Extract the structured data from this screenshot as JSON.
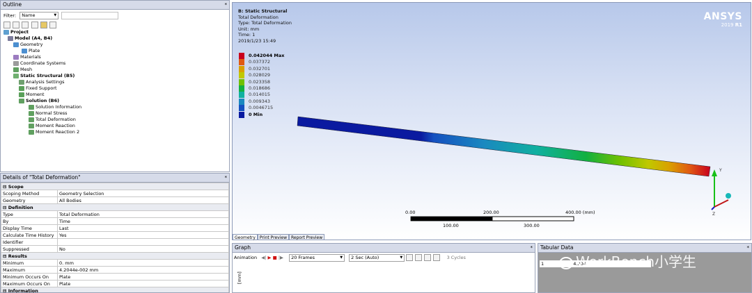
{
  "outline": {
    "title": "Outline",
    "filter_label": "Filter:",
    "filter_value": "Name",
    "tree": [
      {
        "label": "Project",
        "bold": true
      },
      {
        "label": "Model (A4, B4)",
        "bold": true
      },
      {
        "label": "Geometry",
        "bold": false
      },
      {
        "label": "Plate",
        "bold": false
      },
      {
        "label": "Materials",
        "bold": false
      },
      {
        "label": "Coordinate Systems",
        "bold": false
      },
      {
        "label": "Mesh",
        "bold": false
      },
      {
        "label": "Static Structural (B5)",
        "bold": true
      },
      {
        "label": "Analysis Settings",
        "bold": false
      },
      {
        "label": "Fixed Support",
        "bold": false
      },
      {
        "label": "Moment",
        "bold": false
      },
      {
        "label": "Solution (B6)",
        "bold": true
      },
      {
        "label": "Solution Information",
        "bold": false
      },
      {
        "label": "Normal Stress",
        "bold": false
      },
      {
        "label": "Total Deformation",
        "bold": false
      },
      {
        "label": "Moment Reaction",
        "bold": false
      },
      {
        "label": "Moment Reaction 2",
        "bold": false
      }
    ]
  },
  "details": {
    "title": "Details of \"Total Deformation\"",
    "rows": [
      {
        "section": "Scope"
      },
      {
        "k": "Scoping Method",
        "v": "Geometry Selection"
      },
      {
        "k": "Geometry",
        "v": "All Bodies"
      },
      {
        "section": "Definition"
      },
      {
        "k": "Type",
        "v": "Total Deformation"
      },
      {
        "k": "By",
        "v": "Time"
      },
      {
        "k": "Display Time",
        "v": "Last"
      },
      {
        "k": "Calculate Time History",
        "v": "Yes"
      },
      {
        "k": "Identifier",
        "v": ""
      },
      {
        "k": "Suppressed",
        "v": "No"
      },
      {
        "section": "Results"
      },
      {
        "k": "Minimum",
        "v": "0. mm"
      },
      {
        "k": "Maximum",
        "v": "4.2044e-002 mm"
      },
      {
        "k": "Minimum Occurs On",
        "v": "Plate"
      },
      {
        "k": "Maximum Occurs On",
        "v": "Plate"
      },
      {
        "section": "Information"
      }
    ]
  },
  "viewport": {
    "header": [
      "B: Static Structural",
      "Total Deformation",
      "Type: Total Deformation",
      "Unit: mm",
      "Time: 1",
      "2019/1/23 15:49"
    ],
    "brand": "ANSYS",
    "version": "2019",
    "release": "R1",
    "legend": [
      {
        "label": "0.042044 Max",
        "color": "#c8001e"
      },
      {
        "label": "0.037372",
        "color": "#e05a12"
      },
      {
        "label": "0.032701",
        "color": "#d9a100"
      },
      {
        "label": "0.028029",
        "color": "#c0c800"
      },
      {
        "label": "0.023358",
        "color": "#6fc000"
      },
      {
        "label": "0.018686",
        "color": "#12b040"
      },
      {
        "label": "0.014015",
        "color": "#10b0a0"
      },
      {
        "label": "0.009343",
        "color": "#1a88c0"
      },
      {
        "label": "0.0046715",
        "color": "#1450c0"
      },
      {
        "label": "0 Min",
        "color": "#0a1aa0"
      }
    ],
    "scale_top": [
      "0.00",
      "200.00",
      "400.00 (mm)"
    ],
    "scale_bottom": [
      "100.00",
      "300.00"
    ],
    "axis_y": "Y",
    "axis_z": "Z",
    "tabs": [
      "Geometry",
      "Print Preview",
      "Report Preview"
    ]
  },
  "graph": {
    "title": "Graph",
    "animation_label": "Animation",
    "frames": "20 Frames",
    "duration": "2 Sec (Auto)",
    "cycles": "3 Cycles",
    "ylabel": "[mm]"
  },
  "tabular": {
    "title": "Tabular Data",
    "row_index": "1",
    "row_value": "4.204"
  },
  "watermark": "WorkBench小学生"
}
